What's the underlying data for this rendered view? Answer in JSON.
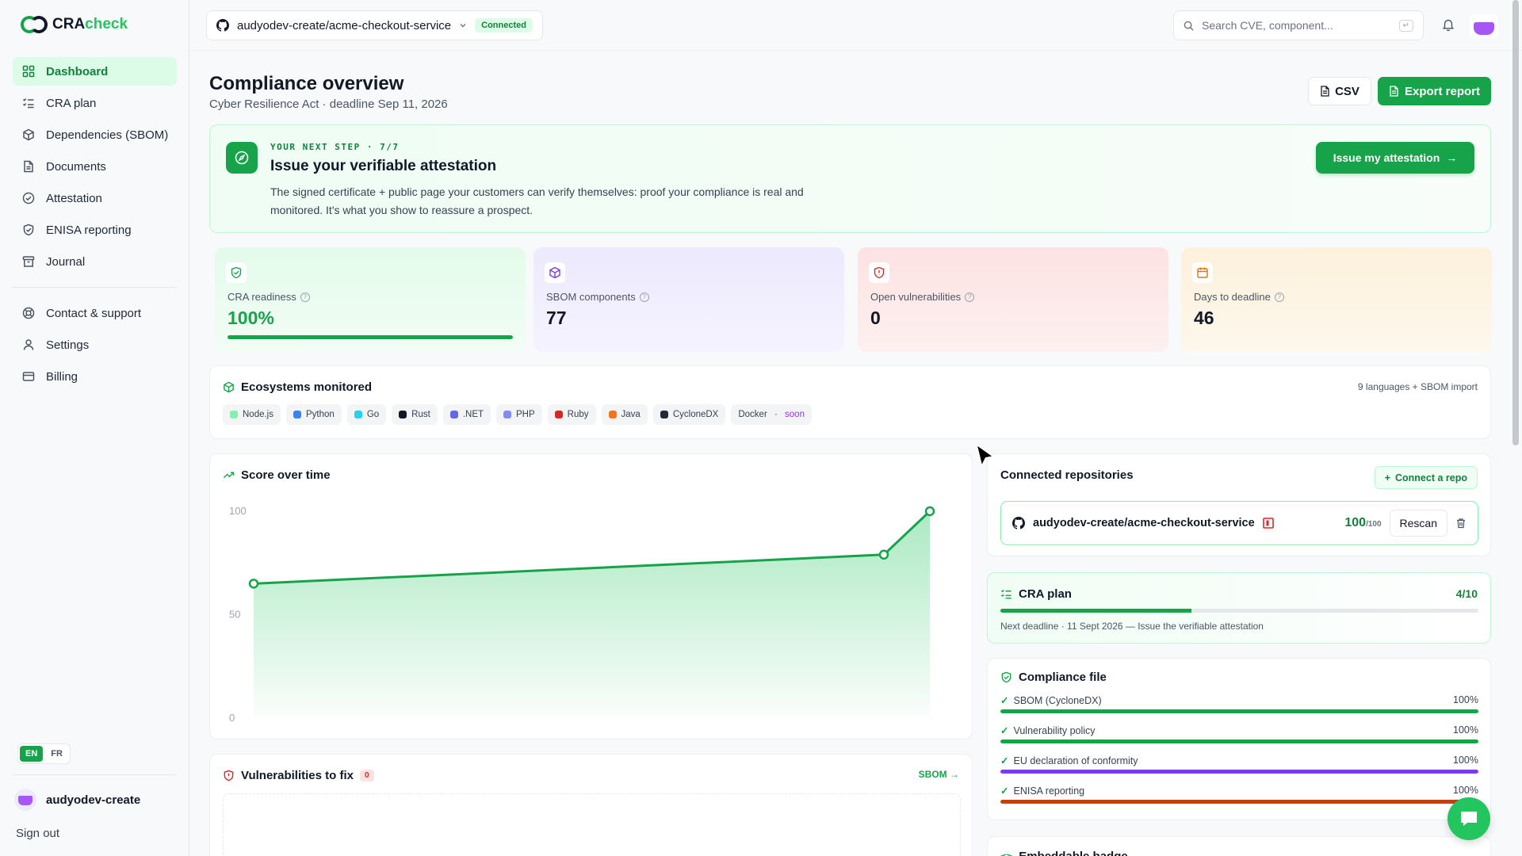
{
  "brand": {
    "cra": "CRA",
    "check": "check"
  },
  "sidebar": {
    "items": [
      {
        "label": "Dashboard"
      },
      {
        "label": "CRA plan"
      },
      {
        "label": "Dependencies (SBOM)"
      },
      {
        "label": "Documents"
      },
      {
        "label": "Attestation"
      },
      {
        "label": "ENISA reporting"
      },
      {
        "label": "Journal"
      }
    ],
    "secondary": [
      {
        "label": "Contact & support"
      },
      {
        "label": "Settings"
      },
      {
        "label": "Billing"
      }
    ],
    "lang": {
      "en": "EN",
      "fr": "FR",
      "active": "EN"
    },
    "user": "audyodev-create",
    "signout": "Sign out"
  },
  "topbar": {
    "repo": "audyodev-create/acme-checkout-service",
    "status": "Connected",
    "search_placeholder": "Search CVE, component..."
  },
  "header": {
    "title": "Compliance overview",
    "subtitle": "Cyber Resilience Act · deadline Sep 11, 2026",
    "csv_label": "CSV",
    "export_label": "Export report"
  },
  "next_step": {
    "kicker": "YOUR NEXT STEP · 7/7",
    "title": "Issue your verifiable attestation",
    "description": "The signed certificate + public page your customers can verify themselves: proof your compliance is real and monitored. It's what you show to reassure a prospect.",
    "button": "Issue my attestation"
  },
  "kpis": [
    {
      "label": "CRA readiness",
      "value": "100%",
      "progress": 1.0,
      "color": "#16a34a",
      "icon": "shield-check-icon"
    },
    {
      "label": "SBOM components",
      "value": "77",
      "color": "#7c3aed",
      "icon": "package-icon"
    },
    {
      "label": "Open vulnerabilities",
      "value": "0",
      "color": "#dc2626",
      "icon": "shield-alert-icon"
    },
    {
      "label": "Days to deadline",
      "value": "46",
      "color": "#d97706",
      "icon": "calendar-icon"
    }
  ],
  "ecosystems": {
    "title": "Ecosystems monitored",
    "note": "9 languages + SBOM import",
    "chips": [
      {
        "label": "Node.js",
        "color": "#86efac"
      },
      {
        "label": "Python",
        "color": "#3b82f6"
      },
      {
        "label": "Go",
        "color": "#22d3ee"
      },
      {
        "label": "Rust",
        "color": "#111827"
      },
      {
        "label": ".NET",
        "color": "#6366f1"
      },
      {
        "label": "PHP",
        "color": "#818cf8"
      },
      {
        "label": "Ruby",
        "color": "#dc2626"
      },
      {
        "label": "Java",
        "color": "#f97316"
      },
      {
        "label": "CycloneDX",
        "color": "#1f2937"
      }
    ],
    "docker": "Docker",
    "docker_sep": " · ",
    "docker_soon": "soon"
  },
  "score_card": {
    "title": "Score over time"
  },
  "chart_data": {
    "type": "line",
    "title": "Score over time",
    "x": [
      0,
      1,
      2
    ],
    "values": [
      65,
      79,
      100
    ],
    "yticks": [
      0,
      50,
      100
    ],
    "ylim": [
      0,
      100
    ],
    "color": "#16a34a",
    "grid": false
  },
  "vulns": {
    "title": "Vulnerabilities to fix",
    "count": "0",
    "link": "SBOM →"
  },
  "repos": {
    "title": "Connected repositories",
    "connect": "Connect a repo",
    "items": [
      {
        "name": "audyodev-create/acme-checkout-service",
        "score": "100",
        "out_of": "/100",
        "rescan": "Rescan"
      }
    ]
  },
  "plan": {
    "title": "CRA plan",
    "progress": "4/10",
    "fraction": 0.4,
    "note": "Next deadline · 11 Sept 2026 — Issue the verifiable attestation"
  },
  "compliance_file": {
    "title": "Compliance file",
    "items": [
      {
        "label": "SBOM (CycloneDX)",
        "pct": "100%",
        "fraction": 1.0,
        "color": "#16a34a"
      },
      {
        "label": "Vulnerability policy",
        "pct": "100%",
        "fraction": 1.0,
        "color": "#16a34a"
      },
      {
        "label": "EU declaration of conformity",
        "pct": "100%",
        "fraction": 1.0,
        "color": "#7c3aed"
      },
      {
        "label": "ENISA reporting",
        "pct": "100%",
        "fraction": 1.0,
        "color": "#c2410c"
      }
    ]
  },
  "badge_card": {
    "title": "Embeddable badge"
  }
}
